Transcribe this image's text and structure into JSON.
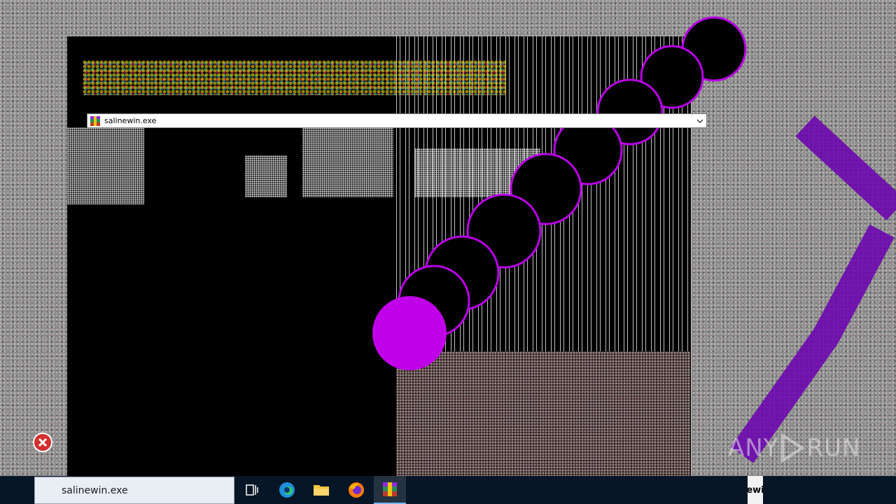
{
  "dropdown": {
    "selected_value": "salinewin.exe",
    "icon": "winrar-archive-icon"
  },
  "taskbar": {
    "search_text": "salinewin.exe",
    "buttons": [
      {
        "name": "task-view",
        "icon": "task-view-icon"
      },
      {
        "name": "edge",
        "icon": "edge-icon"
      },
      {
        "name": "file-explorer",
        "icon": "folder-icon"
      },
      {
        "name": "firefox",
        "icon": "firefox-icon"
      },
      {
        "name": "winrar",
        "icon": "winrar-icon",
        "active": true
      }
    ],
    "overflow_text": "ewi"
  },
  "watermark": {
    "left": "ANY",
    "right": "RUN"
  },
  "colors": {
    "taskbar_bg": "#071626",
    "trail_purple": "#b800e6",
    "dropdown_bg": "#ffffff"
  }
}
